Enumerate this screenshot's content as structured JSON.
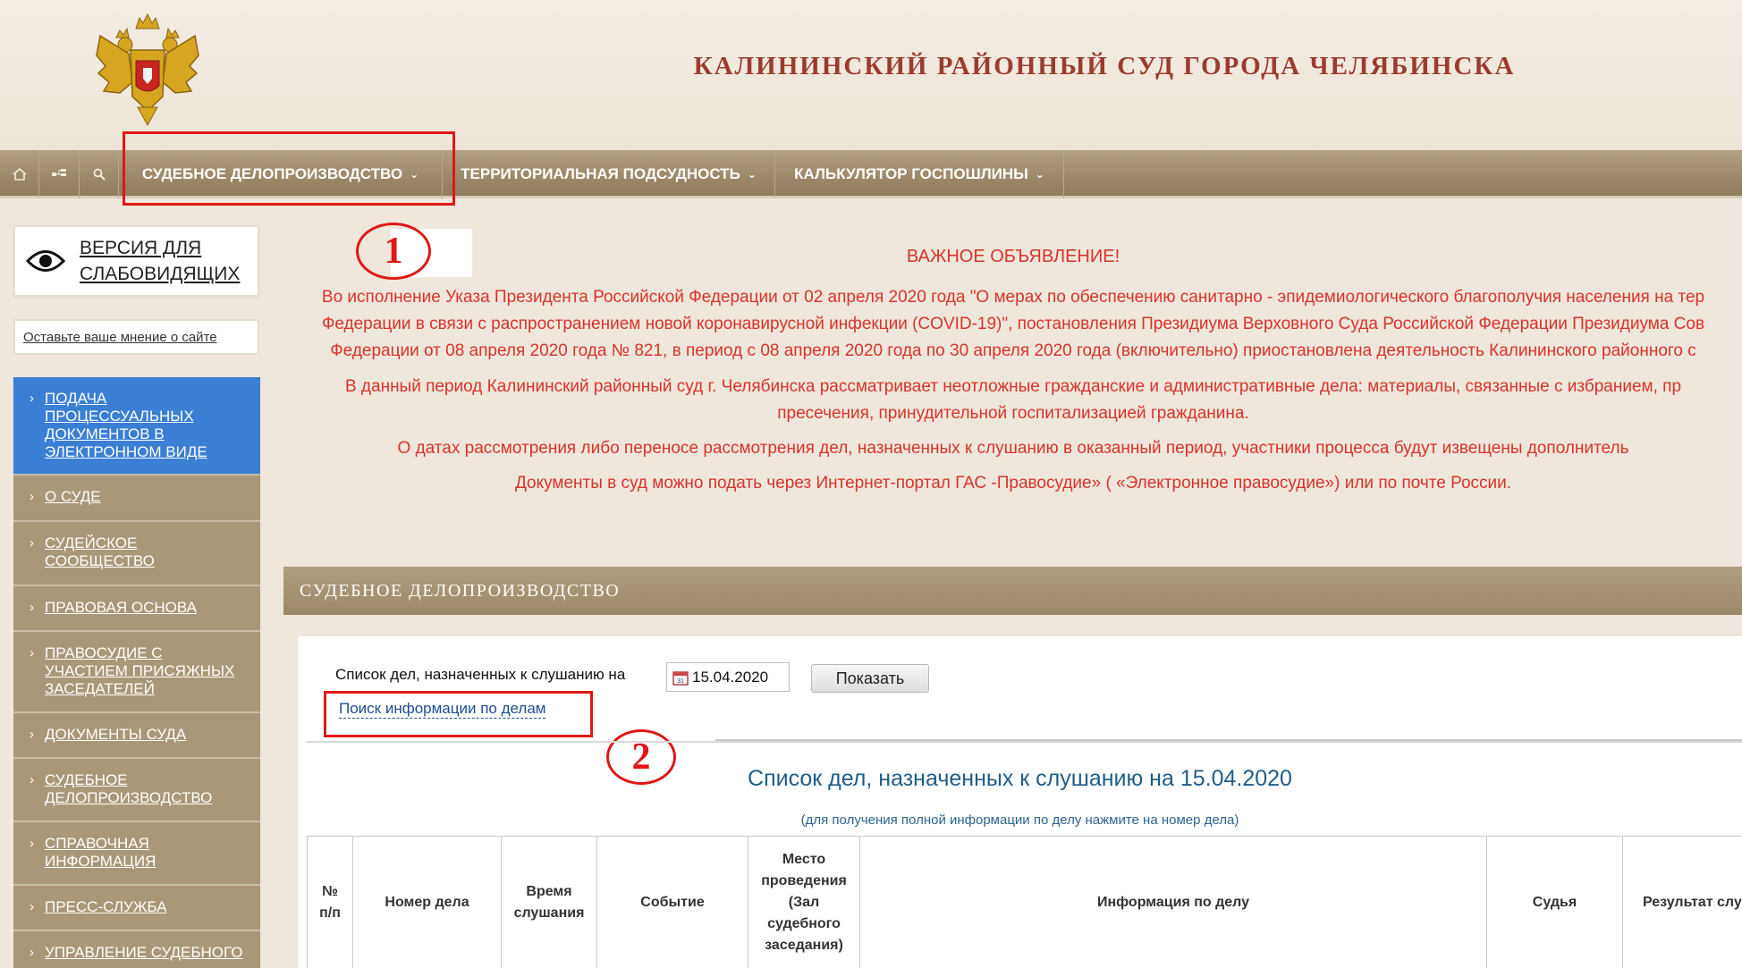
{
  "header": {
    "court_title": "КАЛИНИНСКИЙ РАЙОННЫЙ СУД ГОРОДА ЧЕЛЯБИНСКА",
    "emblem": "russian-coat-of-arms-emblem"
  },
  "nav": {
    "icons": [
      "home-icon",
      "sitemap-icon",
      "search-icon"
    ],
    "items": [
      {
        "label": "СУДЕБНОЕ ДЕЛОПРОИЗВОДСТВО"
      },
      {
        "label": "ТЕРРИТОРИАЛЬНАЯ ПОДСУДНОСТЬ"
      },
      {
        "label": "КАЛЬКУЛЯТОР ГОСПОШЛИНЫ"
      }
    ],
    "caret": "⌄"
  },
  "sidebar": {
    "vision_link": {
      "line1": "ВЕРСИЯ ДЛЯ",
      "line2": "СЛАБОВИДЯЩИХ"
    },
    "feedback_link": "Оставьте ваше мнение о сайте",
    "items": [
      {
        "label": "Подача процессуальных документов в электронном виде"
      },
      {
        "label": "О суде"
      },
      {
        "label": "Судейское сообщество"
      },
      {
        "label": "Правовая основа"
      },
      {
        "label": "Правосудие с участием присяжных заседателей"
      },
      {
        "label": "Документы суда"
      },
      {
        "label": "Судебное делопроизводство"
      },
      {
        "label": "Справочная информация"
      },
      {
        "label": "Пресс-служба"
      },
      {
        "label": "Управление судебного"
      }
    ]
  },
  "annotations": {
    "step1": "1",
    "step2": "2",
    "highlight_color": "#e01717"
  },
  "notice": {
    "title": "ВАЖНОЕ ОБЪЯВЛЕНИЕ!",
    "p1_line1": "Во исполнение Указа Президента Российской Федерации от 02 апреля 2020 года \"О мерах по обеспечению санитарно - эпидемиологического благополучия населения на тер",
    "p1_line2": "Федерации в связи с распространением новой коронавирусной инфекции (COVID-19)\", постановления Президиума Верховного Суда Российской Федерации Президиума Сов",
    "p1_line3": "Федерации от 08 апреля 2020 года № 821, в период с 08 апреля 2020 года по 30 апреля 2020 года (включительно) приостановлена деятельность Калининского районного с",
    "p2_line1": "В данный период Калининский районный суд г. Челябинска рассматривает неотложные гражданские и административные дела: материалы, связанные с избранием, пр",
    "p2_line2": "пресечения, принудительной госпитализацией гражданина.",
    "p3": "О датах рассмотрения либо переносе рассмотрения дел, назначенных к слушанию в оказанный период, участники процесса будут извещены дополнитель",
    "p4": "Документы в суд можно подать через Интернет-портал ГАС -Правосудие» ( «Электронное правосудие») или по почте России."
  },
  "section": {
    "title": "СУДЕБНОЕ ДЕЛОПРОИЗВОДСТВО",
    "list_label": "Список дел, назначенных к слушанию на",
    "date_value": "15.04.2020",
    "show_button": "Показать",
    "search_link": "Поиск информации по делам",
    "list_title": "Список дел, назначенных к слушанию на 15.04.2020",
    "list_subtitle": "(для получения полной информации по делу нажмите на номер дела)"
  },
  "table": {
    "columns": [
      "№\nп/п",
      "Номер дела",
      "Время\nслушания",
      "Событие",
      "Место\nпроведения\n(Зал\nсудебного\nзаседания)",
      "Информация по делу",
      "Судья",
      "Результат слу"
    ]
  }
}
